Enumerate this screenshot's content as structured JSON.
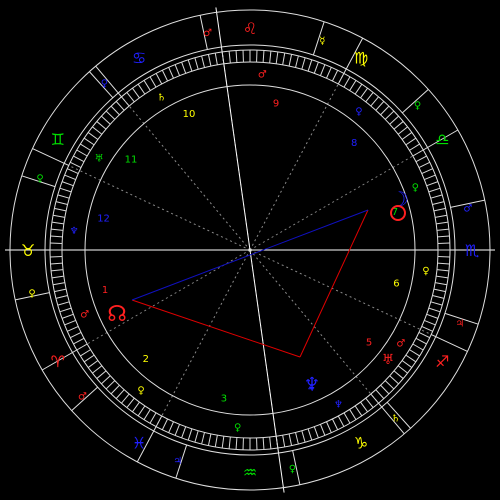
{
  "colors": {
    "background": "#000000",
    "ring_line": "#e0e0e0",
    "axis_line": "#ffffff",
    "division_line": "#9a9a9a",
    "fire": "#ff2020",
    "earth": "#ffff00",
    "air": "#00e000",
    "water": "#2020ff",
    "aspect_red": "#e00000",
    "aspect_blue": "#1010c0"
  },
  "signs": [
    {
      "name": "Leo",
      "glyph": "♌",
      "element": "fire",
      "ruler": "♂"
    },
    {
      "name": "Cancer",
      "glyph": "♋",
      "element": "water",
      "ruler": "♀"
    },
    {
      "name": "Gemini",
      "glyph": "♊",
      "element": "air",
      "ruler": "♀"
    },
    {
      "name": "Taurus",
      "glyph": "♉",
      "element": "earth",
      "ruler": "♀"
    },
    {
      "name": "Aries",
      "glyph": "♈",
      "element": "fire",
      "ruler": "♂"
    },
    {
      "name": "Pisces",
      "glyph": "♓",
      "element": "water",
      "ruler": "♃"
    },
    {
      "name": "Aquarius",
      "glyph": "♒",
      "element": "air",
      "ruler": "♀"
    },
    {
      "name": "Capricorn",
      "glyph": "♑",
      "element": "earth",
      "ruler": "♄"
    },
    {
      "name": "Sagittarius",
      "glyph": "♐",
      "element": "fire",
      "ruler": "♃"
    },
    {
      "name": "Scorpio",
      "glyph": "♏",
      "element": "water",
      "ruler": "♂"
    },
    {
      "name": "Libra",
      "glyph": "♎",
      "element": "air",
      "ruler": "♀"
    },
    {
      "name": "Virgo",
      "glyph": "♍",
      "element": "earth",
      "ruler": "☿"
    }
  ],
  "houses": [
    {
      "number": "1",
      "element": "fire",
      "ruler": "♂"
    },
    {
      "number": "2",
      "element": "earth",
      "ruler": "♀"
    },
    {
      "number": "3",
      "element": "air",
      "ruler": "♀"
    },
    {
      "number": "4",
      "element": "water",
      "ruler": "♆"
    },
    {
      "number": "5",
      "element": "fire",
      "ruler": "♂"
    },
    {
      "number": "6",
      "element": "earth",
      "ruler": "♀"
    },
    {
      "number": "7",
      "element": "air",
      "ruler": "♀"
    },
    {
      "number": "8",
      "element": "water",
      "ruler": "♀"
    },
    {
      "number": "9",
      "element": "fire",
      "ruler": "♂"
    },
    {
      "number": "10",
      "element": "earth",
      "ruler": "♄"
    },
    {
      "number": "11",
      "element": "air",
      "ruler": "♅"
    },
    {
      "number": "12",
      "element": "water",
      "ruler": "♆"
    }
  ],
  "planets": [
    {
      "name": "Moon",
      "glyph": "☽",
      "color": "#2020ff"
    },
    {
      "name": "North Node",
      "glyph": "☊",
      "color": "#2020ff"
    },
    {
      "name": "Sun",
      "glyph": "○",
      "color": "#ff2020"
    },
    {
      "name": "Neptune",
      "glyph": "♆",
      "color": "#2020ff"
    },
    {
      "name": "Uranus",
      "glyph": "♅",
      "color": "#ff2020"
    }
  ]
}
